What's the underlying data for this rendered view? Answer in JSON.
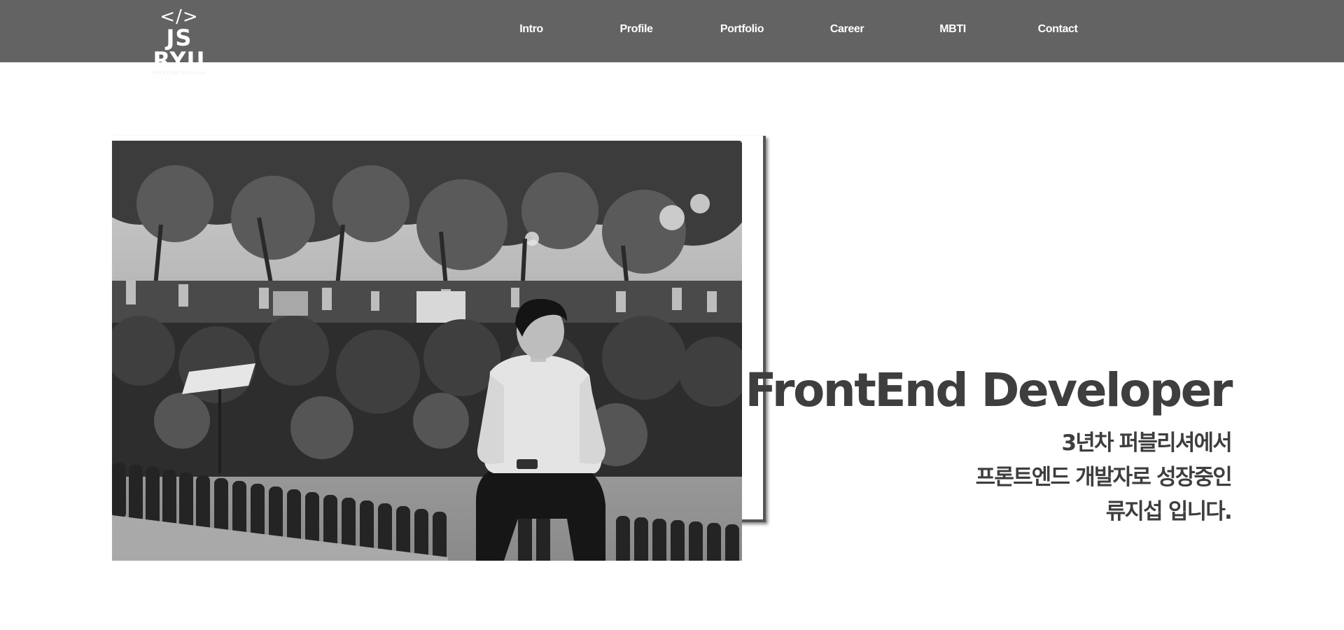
{
  "logo": {
    "mark": "</>",
    "name": "JS RYU",
    "subtitle": "FRONTEND DEVELOP"
  },
  "nav": {
    "items": [
      "Intro",
      "Profile",
      "Portfolio",
      "Career",
      "MBTI",
      "Contact"
    ]
  },
  "hero": {
    "title": "FrontEnd Developer",
    "lines": [
      "3년차 퍼블리셔에서",
      "프론트엔드 개발자로 성장중인",
      "류지섭 입니다."
    ]
  },
  "colors": {
    "header_bg": "#636363",
    "text_dark": "#3e3e3e",
    "frame": "#555555"
  }
}
